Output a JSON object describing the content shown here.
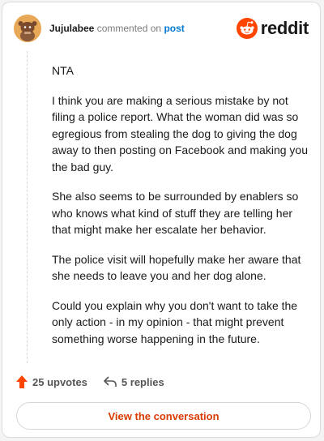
{
  "header": {
    "username": "Jujulabee",
    "action_text": "commented on",
    "post_link": "post",
    "brand": "reddit"
  },
  "comment": {
    "paragraphs": [
      "NTA",
      "I think you are making a serious mistake by not filing a police report. What the woman did was so egregious from stealing the dog to giving the dog away to then posting on Facebook and making you the bad guy.",
      "She also seems to be surrounded by enablers so who knows what kind of stuff they are telling her that might make her escalate her behavior.",
      "The police visit will hopefully make her aware that she needs to leave you and her dog alone.",
      "Could you explain why you don't want to take the only action - in my opinion - that might prevent something worse happening in the future."
    ]
  },
  "actions": {
    "upvotes": "25 upvotes",
    "replies": "5 replies"
  },
  "cta": {
    "label": "View the conversation"
  },
  "icons": {
    "avatar": "snoo-avatar-icon",
    "logo": "reddit-logo-icon",
    "upvote": "upvote-arrow-icon",
    "reply": "reply-arrow-icon"
  },
  "colors": {
    "brand_orange": "#ff4500",
    "upvote": "#ff4500",
    "link_blue": "#0079d3",
    "cta_text": "#d93a00",
    "avatar_bg": "#e7a958"
  }
}
